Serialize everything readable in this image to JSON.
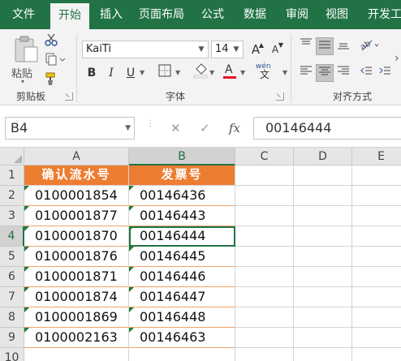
{
  "ribbon_tabs": [
    "文件",
    "开始",
    "插入",
    "页面布局",
    "公式",
    "数据",
    "审阅",
    "视图",
    "开发工具"
  ],
  "active_tab": "开始",
  "clipboard": {
    "paste_label": "粘贴",
    "group_label": "剪贴板"
  },
  "font": {
    "name": "KaiTi",
    "size": "14",
    "group_label": "字体",
    "bold": "B",
    "italic": "I",
    "underline": "U",
    "grow": "A",
    "shrink": "A",
    "wen": "wén",
    "color_accent": "#e81123"
  },
  "alignment": {
    "group_label": "对齐方式"
  },
  "formula_bar": {
    "cell_ref": "B4",
    "cancel": "✕",
    "enter": "✓",
    "fx": "fx",
    "value": "00146444"
  },
  "grid": {
    "columns": [
      "A",
      "B",
      "C",
      "D",
      "E"
    ],
    "rows": [
      "1",
      "2",
      "3",
      "4",
      "5",
      "6",
      "7",
      "8",
      "9",
      "10"
    ],
    "header": {
      "a": "确认流水号",
      "b": "发票号"
    },
    "data": [
      {
        "a": "0100001854",
        "b": "00146436"
      },
      {
        "a": "0100001877",
        "b": "00146443"
      },
      {
        "a": "0100001870",
        "b": "00146444"
      },
      {
        "a": "0100001876",
        "b": "00146445"
      },
      {
        "a": "0100001871",
        "b": "00146446"
      },
      {
        "a": "0100001874",
        "b": "00146447"
      },
      {
        "a": "0100001869",
        "b": "00146448"
      },
      {
        "a": "0100002163",
        "b": "00146463"
      }
    ],
    "header_fill": "#ed7d31",
    "error_marker_color": "#1e7b34"
  },
  "theme": {
    "brand": "#217346"
  }
}
